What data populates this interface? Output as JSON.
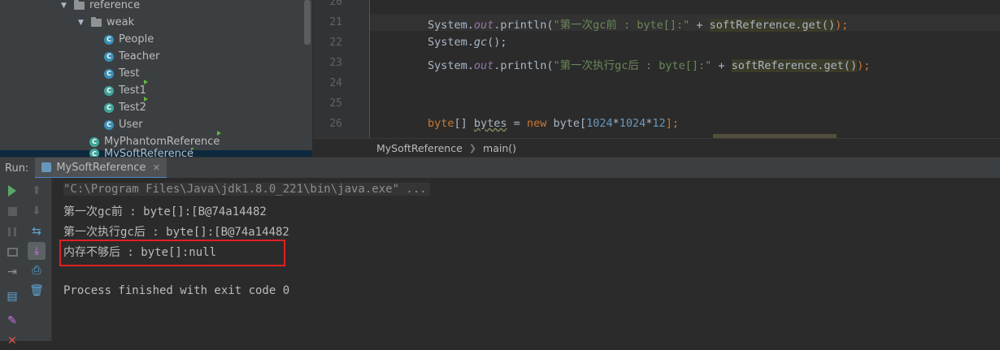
{
  "project_tree": {
    "items": [
      {
        "label": "reference",
        "kind": "folder"
      },
      {
        "label": "weak",
        "kind": "folder"
      },
      {
        "label": "People",
        "kind": "class"
      },
      {
        "label": "Teacher",
        "kind": "class"
      },
      {
        "label": "Test",
        "kind": "class"
      },
      {
        "label": "Test1",
        "kind": "class-exec"
      },
      {
        "label": "Test2",
        "kind": "class-exec"
      },
      {
        "label": "User",
        "kind": "class"
      },
      {
        "label": "MyPhantomReference",
        "kind": "class-exec"
      },
      {
        "label": "MySoftReference",
        "kind": "class-exec"
      }
    ]
  },
  "editor": {
    "line_numbers": [
      "20",
      "21",
      "22",
      "23",
      "24",
      "25",
      "26"
    ],
    "lines": {
      "l21": {
        "a": "System.",
        "b": "out",
        "c": ".println(",
        "d": "\"第一次gc前 : byte[]:\"",
        "e": " + ",
        "f": "softReference.get()",
        "g": ");"
      },
      "l22": {
        "a": "System.",
        "b": "gc",
        "c": "();"
      },
      "l23": {
        "a": "System.",
        "b": "out",
        "c": ".println(",
        "d": "\"第一次执行gc后 : byte[]:\"",
        "e": " + ",
        "f": "softReference.get()",
        "g": ");"
      },
      "l26": {
        "a": "byte",
        "b": "[] ",
        "c": "bytes",
        "d": " = ",
        "e": "new",
        "f": " byte[",
        "g": "1024",
        "h": "*",
        "i": "1024",
        "j": "*",
        "k": "12",
        "l": "];"
      }
    }
  },
  "breadcrumb": {
    "class_name": "MySoftReference",
    "method": "main()"
  },
  "run_window": {
    "label": "Run:",
    "tab_label": "MySoftReference",
    "close_glyph": "×"
  },
  "console": {
    "command": "\"C:\\Program Files\\Java\\jdk1.8.0_221\\bin\\java.exe\" ...",
    "line1": "第一次gc前 : byte[]:[B@74a14482",
    "line2": "第一次执行gc后 : byte[]:[B@74a14482",
    "line3": "内存不够后 : byte[]:null",
    "line5": "Process finished with exit code 0"
  },
  "colors": {
    "highlight_box": "#e02020",
    "accent_tab": "#4a88c7"
  },
  "icons": [
    "play-icon",
    "stop-icon",
    "pause-icon",
    "dump-threads-icon",
    "exit-icon",
    "layout-icon",
    "pin-icon",
    "close-icon",
    "up-arrow-icon",
    "down-arrow-icon",
    "soft-wrap-icon",
    "scroll-to-end-icon",
    "print-icon",
    "trash-icon"
  ]
}
